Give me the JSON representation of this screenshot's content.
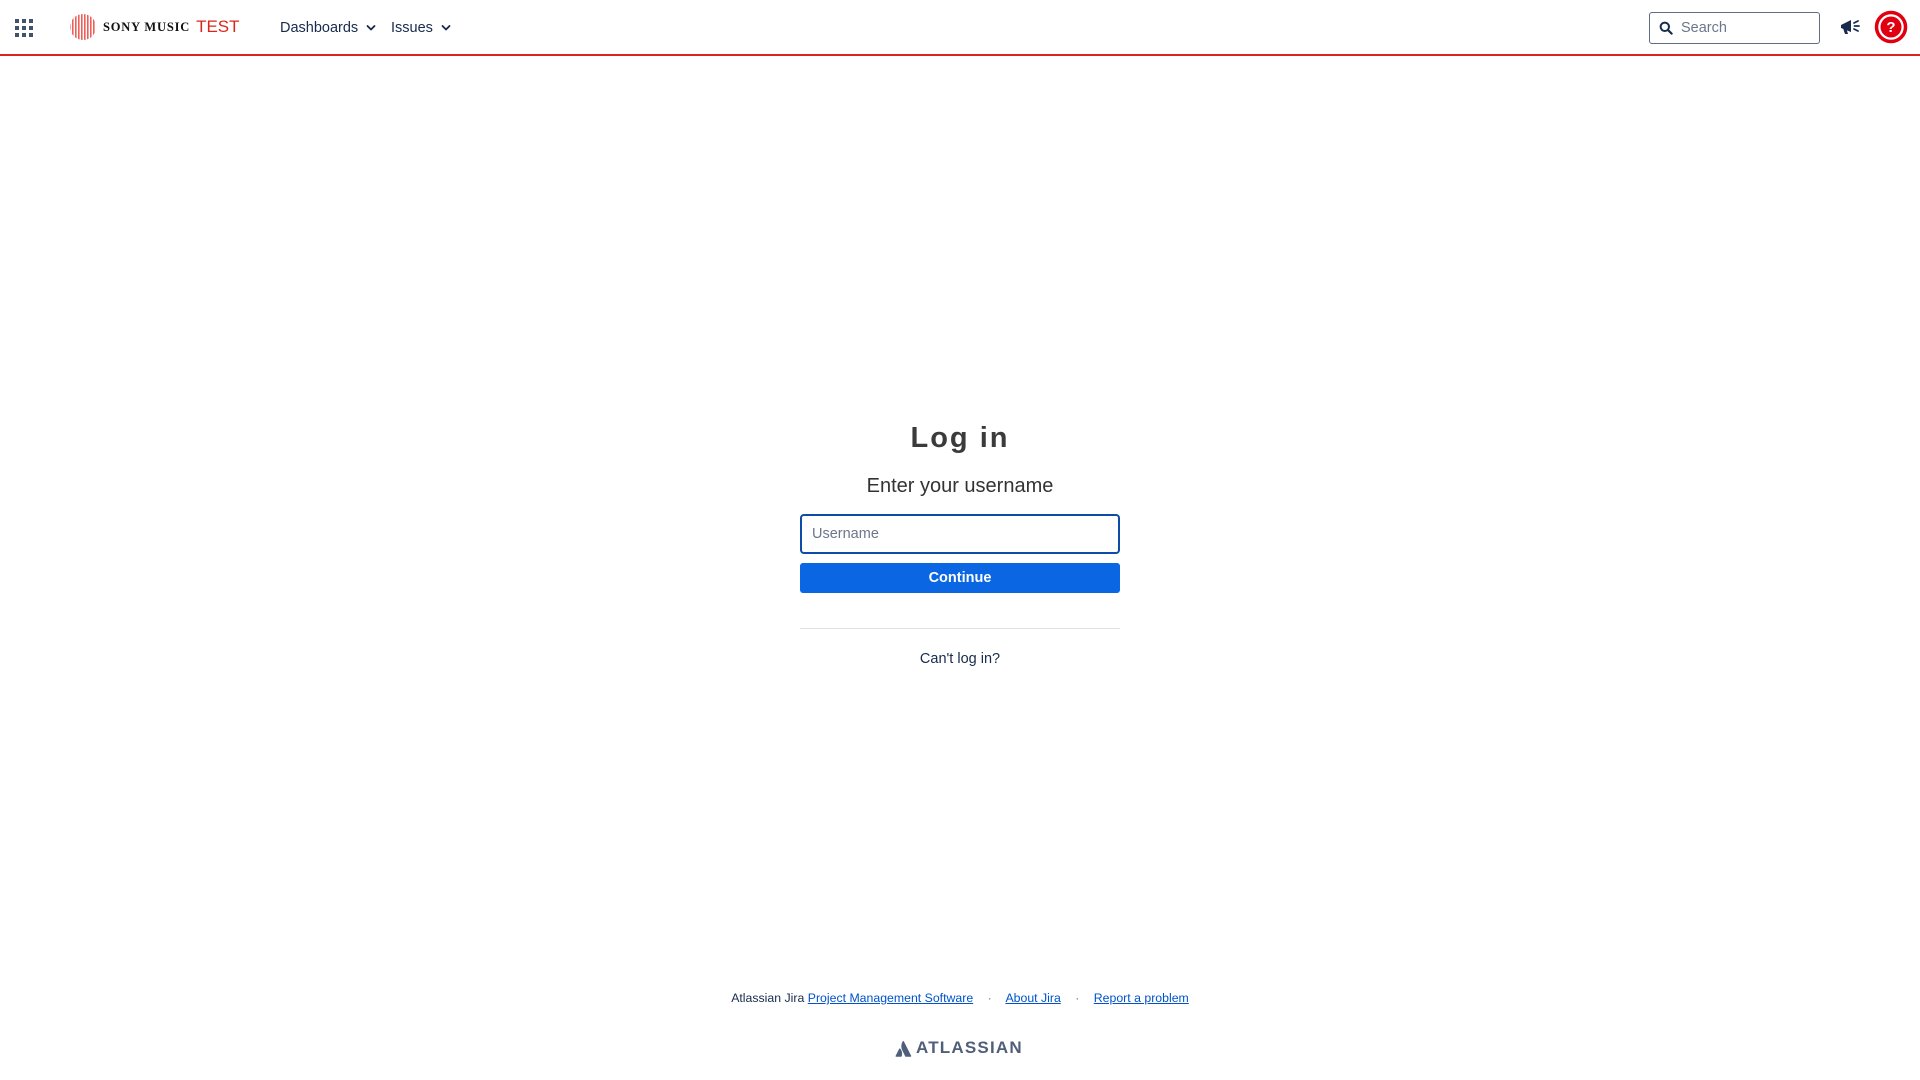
{
  "header": {
    "logo_text": "SONY MUSIC",
    "logo_env": "TEST",
    "nav": [
      {
        "label": "Dashboards",
        "icon": "chevron-down-icon"
      },
      {
        "label": "Issues",
        "icon": "chevron-down-icon"
      }
    ],
    "search_placeholder": "Search",
    "icons": [
      "app-switcher-icon",
      "sony-music-logo",
      "search-icon",
      "megaphone-icon",
      "help-icon"
    ]
  },
  "login": {
    "title": "Log in",
    "subtitle": "Enter your username",
    "username_placeholder": "Username",
    "username_value": "",
    "continue_label": "Continue",
    "cant_login_label": "Can't log in?"
  },
  "footer": {
    "prefix": "Atlassian Jira",
    "links": [
      "Project Management Software",
      "About Jira",
      "Report a problem"
    ],
    "separator": "·",
    "brand": "ATLASSIAN"
  },
  "colors": {
    "header_border": "#d9261c",
    "env_label": "#d9261c",
    "primary_button": "#0b66e4",
    "input_focus_border": "#0c4da8",
    "link": "#0052cc",
    "help_icon": "#e1000f"
  }
}
